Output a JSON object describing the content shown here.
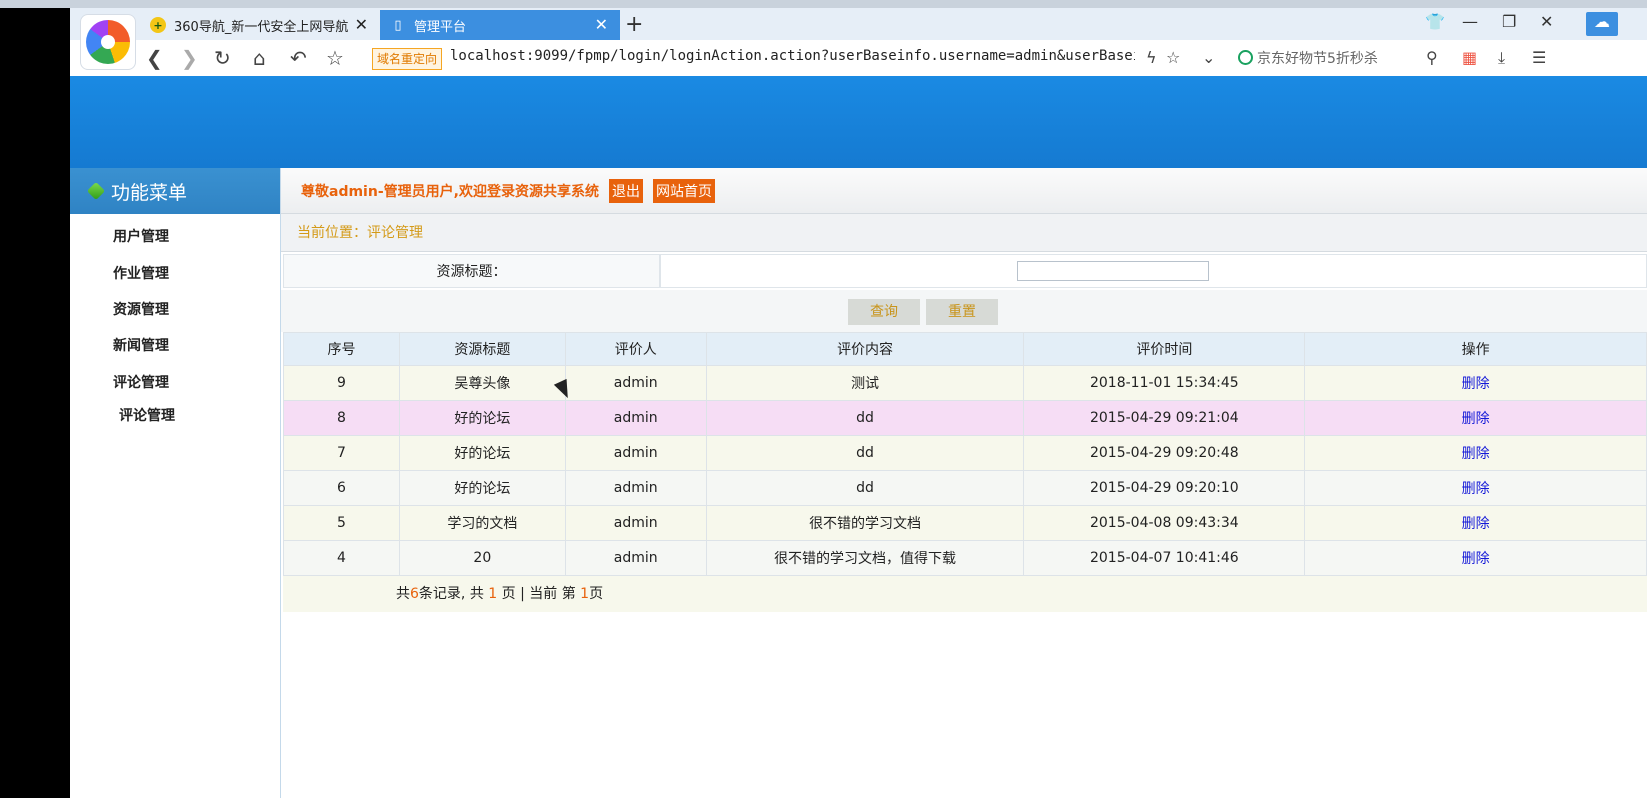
{
  "browser": {
    "tabs": [
      {
        "title": "360导航_新一代安全上网导航"
      },
      {
        "title": "管理平台"
      }
    ],
    "redirect_badge": "域名重定向",
    "url": "localhost:9099/fpmp/login/loginAction.action?userBaseinfo.username=admin&userBasei",
    "search_hint": "京东好物节5折秒杀"
  },
  "sidebar": {
    "title": "功能菜单",
    "items": [
      {
        "label": "用户管理"
      },
      {
        "label": "作业管理"
      },
      {
        "label": "资源管理"
      },
      {
        "label": "新闻管理"
      },
      {
        "label": "评论管理"
      }
    ],
    "subitem": "评论管理"
  },
  "header": {
    "welcome": "尊敬admin-管理员用户,欢迎登录资源共享系统",
    "logout": "退出",
    "home": "网站首页"
  },
  "breadcrumb": "当前位置：评论管理",
  "filter": {
    "label": "资源标题：",
    "value": "",
    "query": "查询",
    "reset": "重置"
  },
  "table": {
    "headers": [
      "序号",
      "资源标题",
      "评价人",
      "评价内容",
      "评价时间",
      "操作"
    ],
    "rows": [
      {
        "id": "9",
        "title": "吴尊头像",
        "user": "admin",
        "content": "测试",
        "time": "2018-11-01 15:34:45",
        "action": "删除"
      },
      {
        "id": "8",
        "title": "好的论坛",
        "user": "admin",
        "content": "dd",
        "time": "2015-04-29 09:21:04",
        "action": "删除"
      },
      {
        "id": "7",
        "title": "好的论坛",
        "user": "admin",
        "content": "dd",
        "time": "2015-04-29 09:20:48",
        "action": "删除"
      },
      {
        "id": "6",
        "title": "好的论坛",
        "user": "admin",
        "content": "dd",
        "time": "2015-04-29 09:20:10",
        "action": "删除"
      },
      {
        "id": "5",
        "title": "学习的文档",
        "user": "admin",
        "content": "很不错的学习文档",
        "time": "2015-04-08 09:43:34",
        "action": "删除"
      },
      {
        "id": "4",
        "title": "20",
        "user": "admin",
        "content": "很不错的学习文档，值得下载",
        "time": "2015-04-07 10:41:46",
        "action": "删除"
      }
    ]
  },
  "pager": {
    "prefix": "共",
    "total": "6",
    "mid1": "条记录, 共 ",
    "pages": "1",
    "mid2": " 页 | 当前 第 ",
    "current": "1",
    "suffix": "页"
  },
  "colors": {
    "banner": "#1a8ae3",
    "accent": "#e8620c",
    "highlight_row": "#f6ddf5",
    "delete_link": "#1419d8"
  }
}
